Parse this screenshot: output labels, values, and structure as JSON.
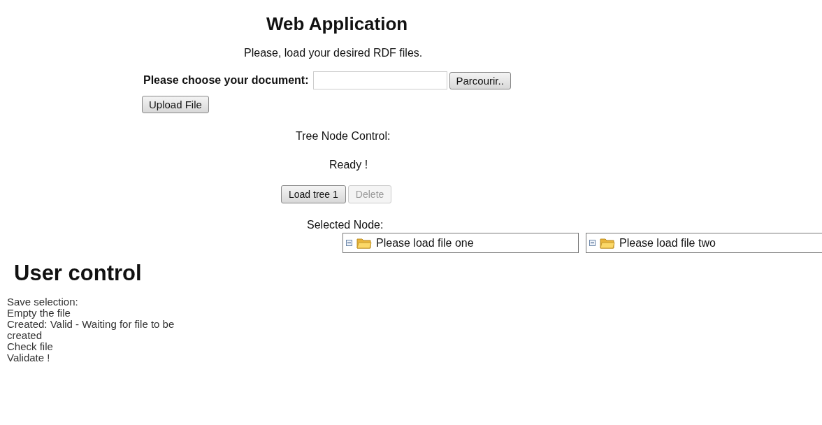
{
  "title": "Web Application",
  "intro": "Please, load your desired RDF files.",
  "upload": {
    "label": "Please choose your document:",
    "browse_button": "Parcourir..",
    "upload_button": "Upload File"
  },
  "tree_control": {
    "label": "Tree Node Control:",
    "status": "Ready !",
    "buttons": [
      {
        "label": "Load tree 1",
        "disabled": false
      },
      {
        "label": "Delete",
        "disabled": true
      }
    ],
    "selected_label": "Selected Node:",
    "trees": [
      {
        "label": "Please load file one",
        "expanded": true
      },
      {
        "label": "Please load file two",
        "expanded": true
      }
    ]
  },
  "user_control": {
    "title": "User control",
    "lines": [
      "Save selection:",
      "Empty the file",
      "Created: Valid - Waiting for file to be created",
      "Check file",
      "Validate !"
    ]
  }
}
